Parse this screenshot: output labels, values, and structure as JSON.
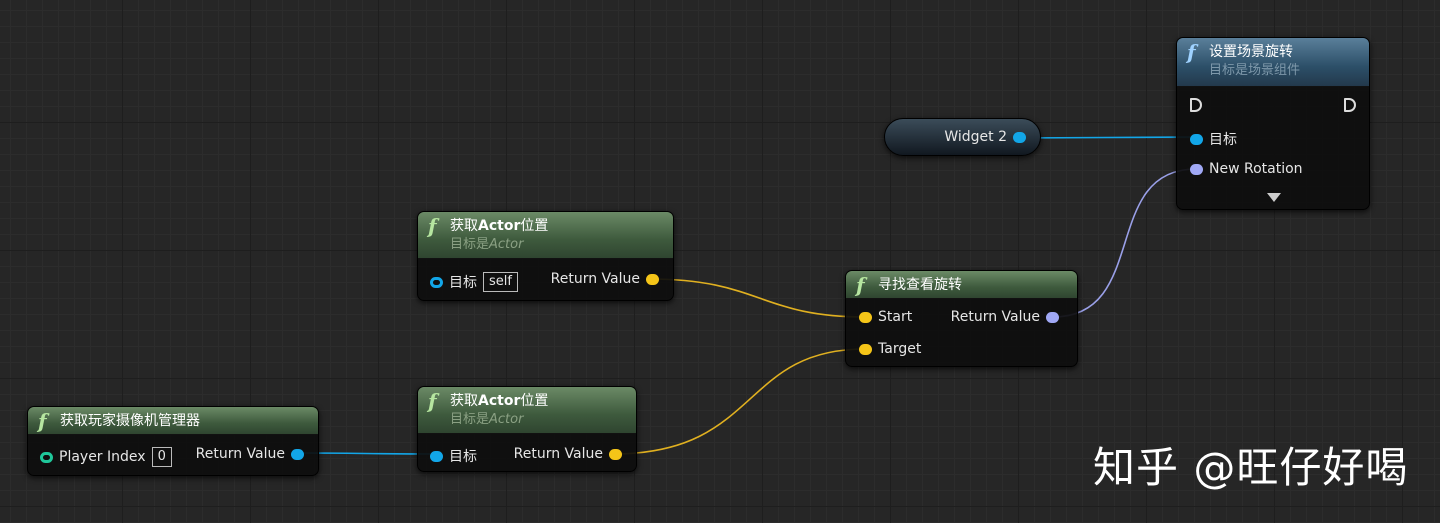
{
  "nodes": {
    "set_rotation": {
      "title": "设置场景旋转",
      "subtitle": "目标是场景组件",
      "pin_target": "目标",
      "pin_new_rotation": "New Rotation"
    },
    "widget_var": {
      "label": "Widget 2"
    },
    "get_location_1": {
      "title_prefix": "获取",
      "title_bold": "Actor",
      "title_suffix": "位置",
      "subtitle_prefix": "目标是",
      "subtitle_italic": "Actor",
      "pin_target": "目标",
      "target_default": "self",
      "return_value": "Return Value"
    },
    "find_look_at": {
      "title": "寻找查看旋转",
      "pin_start": "Start",
      "pin_target": "Target",
      "return_value": "Return Value"
    },
    "get_camera_manager": {
      "title": "获取玩家摄像机管理器",
      "pin_player_index": "Player Index",
      "player_index_value": "0",
      "return_value": "Return Value"
    },
    "get_location_2": {
      "title_prefix": "获取",
      "title_bold": "Actor",
      "title_suffix": "位置",
      "subtitle_prefix": "目标是",
      "subtitle_italic": "Actor",
      "pin_target": "目标",
      "return_value": "Return Value"
    }
  },
  "watermark": "知乎 @旺仔好喝",
  "colors": {
    "object_pin": "#12a6e8",
    "vector_pin": "#f5c518",
    "rotator_pin": "#a0a8f5",
    "int_pin": "#1fc79a"
  }
}
